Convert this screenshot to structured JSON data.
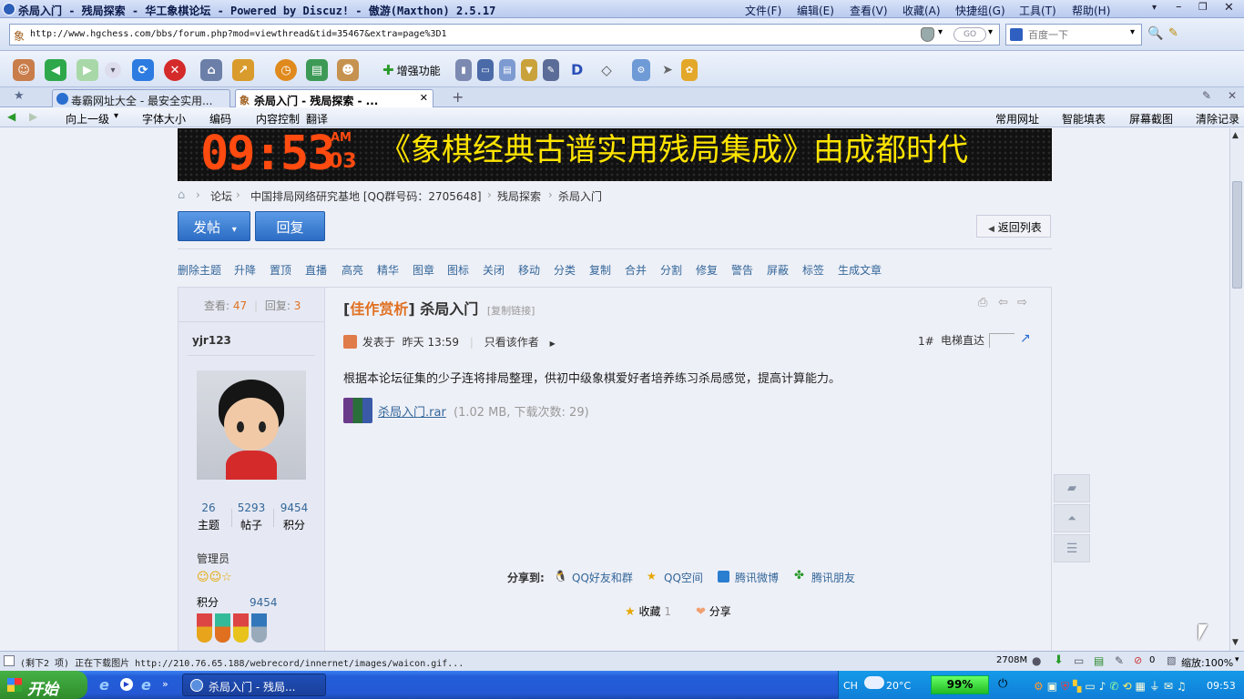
{
  "window": {
    "title": "杀局入门 - 残局探索 - 华工象棋论坛 - Powered by Discuz! - 傲游(Maxthon) 2.5.17",
    "menus": [
      "文件(F)",
      "编辑(E)",
      "查看(V)",
      "收藏(A)",
      "快捷组(G)",
      "工具(T)",
      "帮助(H)"
    ]
  },
  "address": {
    "url": "http://www.hgchess.com/bbs/forum.php?mod=viewthread&tid=35467&extra=page%3D1",
    "go": "GO",
    "search_placeholder": "百度一下"
  },
  "toolbar": {
    "enhance": "增强功能",
    "d": "D"
  },
  "tabs": [
    {
      "label": "毒霸网址大全 - 最安全实用...",
      "active": false
    },
    {
      "label": "杀局入门 - 残局探索 - ...",
      "active": true
    }
  ],
  "tb2": {
    "up": "向上一级",
    "font": "字体大小",
    "encoding": "编码",
    "content_ctrl": "内容控制",
    "translate": "翻译",
    "fav_sites": "常用网址",
    "autofill": "智能填表",
    "screenshot": "屏幕截图",
    "clear": "清除记录"
  },
  "banner": {
    "time": "09:53",
    "am": "AM",
    "day": "03",
    "text": "《象棋经典古谱实用残局集成》由成都时代"
  },
  "breadcrumb": [
    "论坛",
    "中国排局网络研究基地 [QQ群号码：2705648]",
    "残局探索",
    "杀局入门"
  ],
  "buttons": {
    "post": "发帖",
    "reply": "回复",
    "back": "返回列表"
  },
  "admin_actions": [
    "删除主题",
    "升降",
    "置顶",
    "直播",
    "高亮",
    "精华",
    "图章",
    "图标",
    "关闭",
    "移动",
    "分类",
    "复制",
    "合并",
    "分割",
    "修复",
    "警告",
    "屏蔽",
    "标签",
    "生成文章"
  ],
  "stats": {
    "views_label": "查看:",
    "views": "47",
    "replies_label": "回复:",
    "replies": "3"
  },
  "thread": {
    "tag": "佳作赏析",
    "title": "杀局入门",
    "copy_link": "[复制链接]",
    "posted_label": "发表于",
    "posted_time": "昨天 13:59",
    "only_author": "只看该作者",
    "floor": "1#",
    "elevator": "电梯直达",
    "body": "根据本论坛征集的少子连将排局整理，供初中级象棋爱好者培养练习杀局感觉，提高计算能力。",
    "attachment_name": "杀局入门.rar",
    "attachment_info": "(1.02 MB, 下载次数: 29)",
    "share_label": "分享到:",
    "share_targets": [
      "QQ好友和群",
      "QQ空间",
      "腾讯微博",
      "腾讯朋友"
    ],
    "fav_label": "收藏",
    "fav_count": "1",
    "share_btn": "分享"
  },
  "author": {
    "name": "yjr123",
    "topics": "26",
    "topics_label": "主题",
    "posts": "5293",
    "posts_label": "帖子",
    "points": "9454",
    "points_label": "积分",
    "group": "管理员",
    "points_row_label": "积分",
    "points_row_value": "9454"
  },
  "status": {
    "text": "(剩下2 项) 正在下载图片 http://210.76.65.188/webrecord/innernet/images/waicon.gif...",
    "memory": "2708M",
    "zoom": "缩放:100%"
  },
  "taskbar": {
    "start": "开始",
    "task": "杀局入门 - 残局...",
    "lang": "CH",
    "temp": "20°C",
    "battery": "99%",
    "clock": "09:53"
  }
}
